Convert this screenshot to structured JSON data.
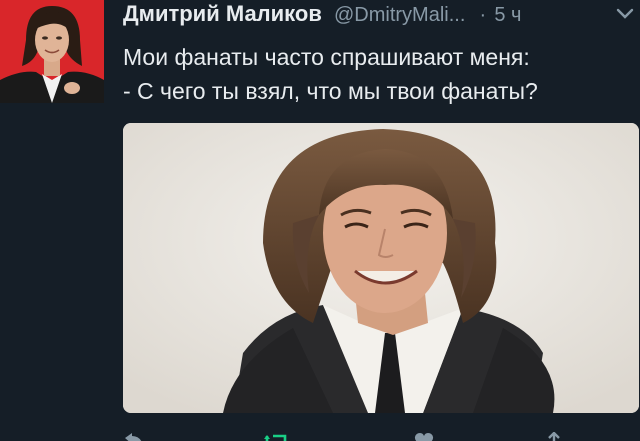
{
  "tweet": {
    "display_name": "Дмитрий Маликов",
    "handle": "@DmitryMali...",
    "separator": "·",
    "time": "5 ч",
    "text_lines": [
      "Мои фанаты часто спрашивают меня:",
      "- С чего ты взял, что мы твои фанаты?"
    ]
  },
  "icons": {
    "more": "chevron-down-icon",
    "reply": "reply-icon",
    "retweet": "retweet-icon",
    "like": "heart-icon",
    "share": "share-icon"
  },
  "colors": {
    "background": "#151e27",
    "text": "#e8ecef",
    "muted": "#8899a6",
    "retweet_active": "#19cf86",
    "avatar_bg": "#d9262a"
  }
}
